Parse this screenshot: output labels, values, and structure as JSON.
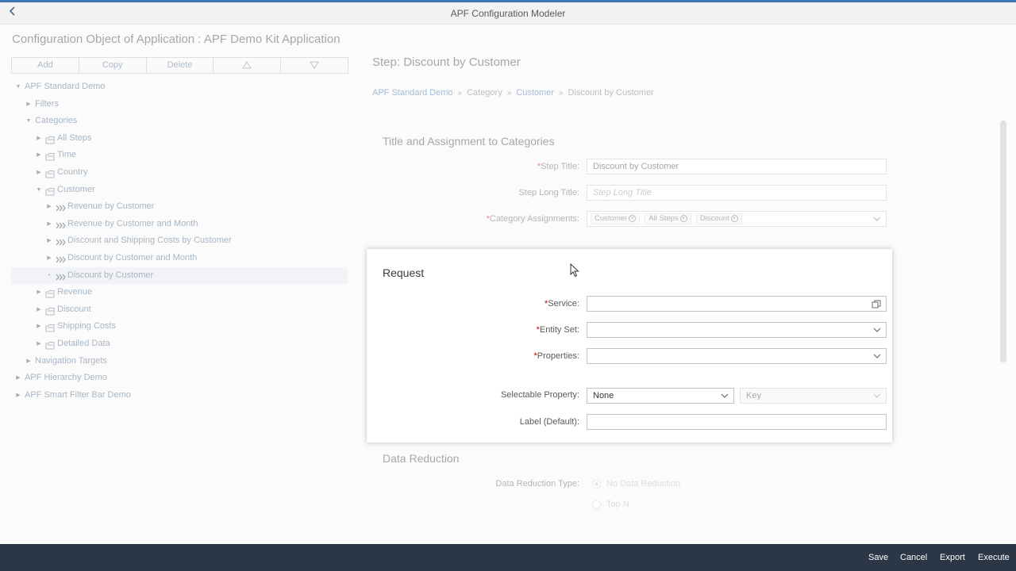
{
  "shell": {
    "title": "APF Configuration Modeler",
    "back_glyph": "‹"
  },
  "app": {
    "title": "Configuration Object of Application : APF Demo Kit Application"
  },
  "toolbar": {
    "add": "Add",
    "copy": "Copy",
    "delete": "Delete",
    "move_up_icon": "triangle-up-icon",
    "move_down_icon": "triangle-down-icon"
  },
  "tree": [
    {
      "label": "APF Standard Demo",
      "level": 0,
      "state": "expanded",
      "icon": "none"
    },
    {
      "label": "Filters",
      "level": 1,
      "state": "collapsed",
      "icon": "none"
    },
    {
      "label": "Categories",
      "level": 1,
      "state": "expanded",
      "icon": "none"
    },
    {
      "label": "All Steps",
      "level": 2,
      "state": "collapsed",
      "icon": "category-icon"
    },
    {
      "label": "Time",
      "level": 2,
      "state": "collapsed",
      "icon": "category-icon"
    },
    {
      "label": "Country",
      "level": 2,
      "state": "collapsed",
      "icon": "category-icon"
    },
    {
      "label": "Customer",
      "level": 2,
      "state": "expanded",
      "icon": "category-icon"
    },
    {
      "label": "Revenue by Customer",
      "level": 3,
      "state": "collapsed",
      "icon": "step-icon"
    },
    {
      "label": "Revenue by Customer and Month",
      "level": 3,
      "state": "collapsed",
      "icon": "step-icon"
    },
    {
      "label": "Discount and Shipping Costs by Customer",
      "level": 3,
      "state": "collapsed",
      "icon": "step-icon"
    },
    {
      "label": "Discount by Customer and Month",
      "level": 3,
      "state": "collapsed",
      "icon": "step-icon"
    },
    {
      "label": "Discount by Customer",
      "level": 3,
      "state": "leaf",
      "icon": "step-icon",
      "selected": true
    },
    {
      "label": "Revenue",
      "level": 2,
      "state": "collapsed",
      "icon": "category-icon"
    },
    {
      "label": "Discount",
      "level": 2,
      "state": "collapsed",
      "icon": "category-icon"
    },
    {
      "label": "Shipping Costs",
      "level": 2,
      "state": "collapsed",
      "icon": "category-icon"
    },
    {
      "label": "Detailed Data",
      "level": 2,
      "state": "collapsed",
      "icon": "category-icon"
    },
    {
      "label": "Navigation Targets",
      "level": 1,
      "state": "collapsed",
      "icon": "none"
    },
    {
      "label": "APF Hierarchy Demo",
      "level": 0,
      "state": "collapsed",
      "icon": "none"
    },
    {
      "label": "APF Smart Filter Bar Demo",
      "level": 0,
      "state": "collapsed",
      "icon": "none"
    }
  ],
  "detail": {
    "step_title": "Step: Discount by Customer",
    "breadcrumb": {
      "b1": "APF Standard Demo",
      "b2": "Category",
      "b3": "Customer",
      "b4": "Discount by Customer"
    },
    "title_section": {
      "heading": "Title and Assignment to Categories",
      "step_title_label": "Step Title:",
      "step_title_value": "Discount by Customer",
      "long_title_label": "Step Long Title:",
      "long_title_placeholder": "Step Long Title",
      "categories_label": "Category Assignments:",
      "tokens": [
        "Customer",
        "All Steps",
        "Discount"
      ]
    },
    "request": {
      "heading": "Request",
      "service_label": "Service:",
      "service_value": "",
      "entity_label": "Entity Set:",
      "entity_value": "",
      "properties_label": "Properties:",
      "properties_value": "",
      "selectable_label": "Selectable Property:",
      "selectable_value": "None",
      "key_value": "Key",
      "label_label": "Label (Default):",
      "label_value": ""
    },
    "data_reduction": {
      "heading": "Data Reduction",
      "type_label": "Data Reduction Type:",
      "opt1": "No Data Reduction",
      "opt2": "Top N"
    }
  },
  "footer": {
    "save": "Save",
    "cancel": "Cancel",
    "export": "Export",
    "execute": "Execute"
  },
  "colors": {
    "accent": "#3a76b3",
    "footer_bg": "#2b3746",
    "link": "#2f6aa6",
    "required": "#bb0000"
  }
}
